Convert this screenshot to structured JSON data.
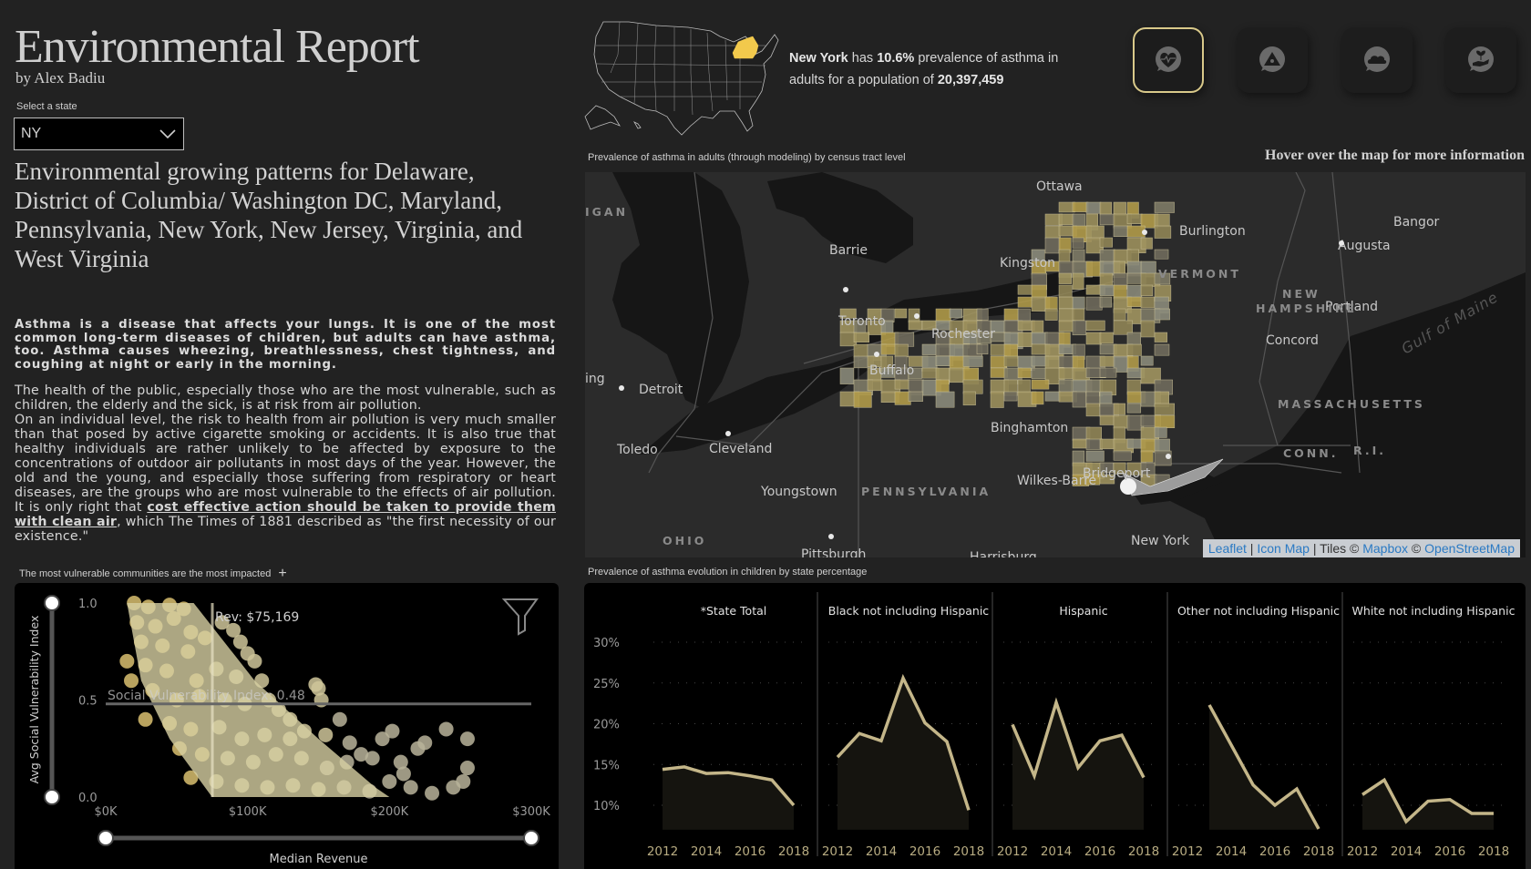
{
  "header": {
    "title": "Environmental Report",
    "byline": "by Alex Badiu"
  },
  "state_selector": {
    "label": "Select a state",
    "selected": "NY"
  },
  "headline": "Environmental growing patterns for Delaware, District of Columbia/ Washington DC, Maryland, Pennsylvania, New York, New Jersey, Virginia, and West Virginia",
  "intro": "Asthma is a disease that affects your lungs. It is one of the most common long-term diseases of children, but adults can have asthma, too. Asthma causes wheezing, breathlessness, chest tightness, and coughing at night or early in the morning.",
  "body": {
    "p1": "The health of the public, especially those who are the most vulnerable, such as children, the elderly and the sick, is at risk from air pollution.",
    "p2_before": "On an individual level, the risk to health from air pollution is very much smaller than that posed by active cigarette smoking or accidents. It is also true that healthy individuals are rather unlikely to be affected by exposure to the concentrations of outdoor air pollutants in most days of the year. However, the old and the young, and especially those suffering from respiratory or heart diseases, are the groups who are most vulnerable to the effects of air pollution. It is only right that ",
    "p2_emphasis": "cost effective action should be taken to provide them with clean air",
    "p2_after": ", which The Times of 1881 described as \"the first necessity of our existence.\""
  },
  "summary": {
    "state_name": "New York",
    "has": " has ",
    "prevalence": "10.6%",
    "middle": " prevalence of asthma in adults for a population of ",
    "population": "20,397,459",
    "highlight_color": "#f2c94c"
  },
  "topic_buttons": [
    {
      "name": "health",
      "icon": "heart-pulse-icon",
      "active": true
    },
    {
      "name": "hazard",
      "icon": "radiation-warning-icon",
      "active": false
    },
    {
      "name": "air",
      "icon": "cloud-icon",
      "active": false
    },
    {
      "name": "environment",
      "icon": "plant-hand-icon",
      "active": false
    }
  ],
  "map": {
    "caption": "Prevalence of asthma in adults (through modeling) by census tract level",
    "hover_hint": "Hover over the map for more information",
    "cities": [
      "Ottawa",
      "Bangor",
      "Burlington",
      "Augusta",
      "Barrie",
      "Kingston",
      "Toronto",
      "Rochester",
      "Portland",
      "Concord",
      "Buffalo",
      "Detroit",
      "Binghamton",
      "Toledo",
      "Cleveland",
      "Wilkes-Barre",
      "Bridgeport",
      "Youngstown",
      "New York",
      "Pittsburgh",
      "Harrisburg",
      "ing"
    ],
    "regions": [
      "IGAN",
      "VERMONT",
      "NEW",
      "HAMPSHIRE",
      "MASSACHUSETTS",
      "CONN.",
      "R.I.",
      "PENNSYLVANIA",
      "OHIO"
    ],
    "water": "Gulf of Maine",
    "attribution": {
      "leaflet": "Leaflet",
      "sep1": " | ",
      "iconmap": "Icon Map",
      "tiles": " | Tiles © ",
      "mapbox": "Mapbox",
      "copy": " © ",
      "osm": "OpenStreetMap"
    },
    "accent": "#b8a86a"
  },
  "scatter": {
    "caption": "The most vulnerable communities are the most impacted",
    "add_label": "+"
  },
  "lines": {
    "caption": "Prevalence of asthma evolution in children by state percentage"
  },
  "chart_data": [
    {
      "type": "scatter",
      "title": "",
      "xlabel": "Median Revenue",
      "ylabel": "Avg Social Vulnerability Index",
      "xlim": [
        0,
        300000
      ],
      "ylim": [
        0,
        1
      ],
      "xticks": [
        "$0K",
        "$100K",
        "$200K",
        "$300K"
      ],
      "yticks": [
        "0.0",
        "0.5",
        "1.0"
      ],
      "reference_lines": {
        "x": {
          "value": 75169,
          "label": "Rev: $75,169"
        },
        "y": {
          "value": 0.48,
          "label": "Social Vulnerability Index: 0.48"
        }
      },
      "description": "Dense cloud of census tracts; vulnerability falls as median revenue rises, with outliers up to ~$255K",
      "points": [
        [
          20000,
          1.0
        ],
        [
          30000,
          0.98
        ],
        [
          45000,
          0.99
        ],
        [
          55000,
          0.97
        ],
        [
          22000,
          0.9
        ],
        [
          35000,
          0.88
        ],
        [
          48000,
          0.92
        ],
        [
          60000,
          0.85
        ],
        [
          25000,
          0.8
        ],
        [
          40000,
          0.78
        ],
        [
          58000,
          0.75
        ],
        [
          70000,
          0.82
        ],
        [
          82000,
          0.9
        ],
        [
          90000,
          0.86
        ],
        [
          95000,
          0.8
        ],
        [
          100000,
          0.74
        ],
        [
          15000,
          0.7
        ],
        [
          28000,
          0.68
        ],
        [
          43000,
          0.65
        ],
        [
          64000,
          0.6
        ],
        [
          78000,
          0.66
        ],
        [
          92000,
          0.62
        ],
        [
          105000,
          0.7
        ],
        [
          110000,
          0.6
        ],
        [
          18000,
          0.6
        ],
        [
          33000,
          0.55
        ],
        [
          50000,
          0.5
        ],
        [
          66000,
          0.52
        ],
        [
          84000,
          0.5
        ],
        [
          98000,
          0.48
        ],
        [
          115000,
          0.5
        ],
        [
          122000,
          0.45
        ],
        [
          130000,
          0.4
        ],
        [
          150000,
          0.56
        ],
        [
          152000,
          0.5
        ],
        [
          148000,
          0.58
        ],
        [
          28000,
          0.4
        ],
        [
          45000,
          0.38
        ],
        [
          60000,
          0.35
        ],
        [
          80000,
          0.36
        ],
        [
          96000,
          0.3
        ],
        [
          112000,
          0.32
        ],
        [
          130000,
          0.3
        ],
        [
          140000,
          0.34
        ],
        [
          155000,
          0.32
        ],
        [
          165000,
          0.4
        ],
        [
          172000,
          0.28
        ],
        [
          52000,
          0.25
        ],
        [
          68000,
          0.22
        ],
        [
          86000,
          0.2
        ],
        [
          104000,
          0.18
        ],
        [
          120000,
          0.22
        ],
        [
          138000,
          0.2
        ],
        [
          156000,
          0.15
        ],
        [
          170000,
          0.18
        ],
        [
          180000,
          0.22
        ],
        [
          188000,
          0.2
        ],
        [
          195000,
          0.3
        ],
        [
          202000,
          0.34
        ],
        [
          60000,
          0.1
        ],
        [
          78000,
          0.08
        ],
        [
          96000,
          0.06
        ],
        [
          114000,
          0.05
        ],
        [
          132000,
          0.06
        ],
        [
          150000,
          0.04
        ],
        [
          168000,
          0.05
        ],
        [
          186000,
          0.03
        ],
        [
          200000,
          0.08
        ],
        [
          210000,
          0.12
        ],
        [
          220000,
          0.25
        ],
        [
          225000,
          0.28
        ],
        [
          230000,
          0.02
        ],
        [
          245000,
          0.05
        ],
        [
          252000,
          0.08
        ],
        [
          255000,
          0.3
        ],
        [
          255000,
          0.15
        ],
        [
          240000,
          0.35
        ],
        [
          208000,
          0.18
        ],
        [
          215000,
          0.05
        ]
      ]
    },
    {
      "type": "line",
      "title": "Prevalence of asthma evolution in children by state percentage",
      "x": [
        2012,
        2013,
        2014,
        2015,
        2016,
        2017,
        2018
      ],
      "xticks": [
        "2012",
        "2014",
        "2016",
        "2018"
      ],
      "yticks": [
        "10%",
        "15%",
        "20%",
        "25%",
        "30%"
      ],
      "ylim": [
        7,
        30
      ],
      "grid": true,
      "series": [
        {
          "name": "*State Total",
          "values": [
            14.4,
            14.7,
            13.9,
            14.0,
            13.6,
            13.1,
            10.0
          ]
        },
        {
          "name": "Black not including Hispanic",
          "values": [
            15.9,
            18.8,
            17.9,
            25.6,
            20.1,
            17.8,
            9.4
          ]
        },
        {
          "name": "Hispanic",
          "values": [
            19.9,
            13.6,
            22.6,
            14.6,
            17.9,
            18.6,
            13.4
          ]
        },
        {
          "name": "Other not including Hispanic",
          "values": [
            null,
            22.3,
            17.4,
            12.5,
            10.0,
            12.0,
            7.1
          ]
        },
        {
          "name": "White not including Hispanic",
          "values": [
            11.3,
            13.1,
            8.0,
            10.5,
            10.7,
            9.0,
            9.0
          ]
        }
      ],
      "line_color": "#c4b689"
    }
  ]
}
